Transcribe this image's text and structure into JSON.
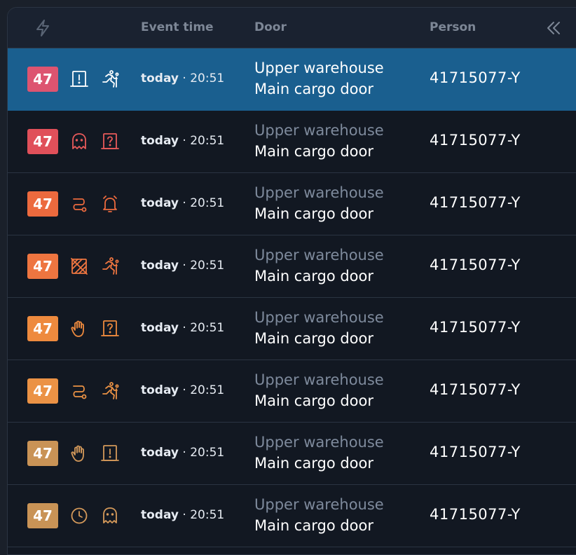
{
  "header": {
    "icon": "lightning-icon",
    "event_time": "Event time",
    "door": "Door",
    "person": "Person",
    "collapse_icon": "double-chevron-left-icon"
  },
  "colors": {
    "header_icon": "#5a6575",
    "selected_row": "#1a5f8f"
  },
  "rows": [
    {
      "badge": "47",
      "badge_color": "#dd5470",
      "icons": [
        "door-alert-icon",
        "running-person-icon"
      ],
      "icon_color": "#ffffff",
      "time_bold": "today",
      "time_rest": " · 20:51",
      "door_area": "Upper warehouse",
      "door_name": "Main cargo door",
      "person": "41715077-Y",
      "selected": true
    },
    {
      "badge": "47",
      "badge_color": "#e0505a",
      "icons": [
        "ghost-icon",
        "door-question-icon"
      ],
      "icon_color": "#e85a5a",
      "time_bold": "today",
      "time_rest": " · 20:51",
      "door_area": "Upper warehouse",
      "door_name": "Main cargo door",
      "person": "41715077-Y",
      "selected": false
    },
    {
      "badge": "47",
      "badge_color": "#ec6a3e",
      "icons": [
        "path-icon",
        "alarm-bell-icon"
      ],
      "icon_color": "#ec6a3e",
      "time_bold": "today",
      "time_rest": " · 20:51",
      "door_area": "Upper warehouse",
      "door_name": "Main cargo door",
      "person": "41715077-Y",
      "selected": false
    },
    {
      "badge": "47",
      "badge_color": "#ee7540",
      "icons": [
        "tamper-icon",
        "running-person-icon"
      ],
      "icon_color": "#ee7540",
      "time_bold": "today",
      "time_rest": " · 20:51",
      "door_area": "Upper warehouse",
      "door_name": "Main cargo door",
      "person": "41715077-Y",
      "selected": false
    },
    {
      "badge": "47",
      "badge_color": "#ee8a3e",
      "icons": [
        "hand-stop-icon",
        "door-question-icon"
      ],
      "icon_color": "#ee8a3e",
      "time_bold": "today",
      "time_rest": " · 20:51",
      "door_area": "Upper warehouse",
      "door_name": "Main cargo door",
      "person": "41715077-Y",
      "selected": false
    },
    {
      "badge": "47",
      "badge_color": "#eb9245",
      "icons": [
        "path-icon",
        "running-person-icon"
      ],
      "icon_color": "#eb9245",
      "time_bold": "today",
      "time_rest": " · 20:51",
      "door_area": "Upper warehouse",
      "door_name": "Main cargo door",
      "person": "41715077-Y",
      "selected": false
    },
    {
      "badge": "47",
      "badge_color": "#c99356",
      "icons": [
        "hand-stop-icon",
        "door-alert-icon"
      ],
      "icon_color": "#d4995a",
      "time_bold": "today",
      "time_rest": " · 20:51",
      "door_area": "Upper warehouse",
      "door_name": "Main cargo door",
      "person": "41715077-Y",
      "selected": false
    },
    {
      "badge": "47",
      "badge_color": "#c99356",
      "icons": [
        "clock-icon",
        "ghost-icon"
      ],
      "icon_color": "#d4995a",
      "time_bold": "today",
      "time_rest": " · 20:51",
      "door_area": "Upper warehouse",
      "door_name": "Main cargo door",
      "person": "41715077-Y",
      "selected": false
    }
  ]
}
